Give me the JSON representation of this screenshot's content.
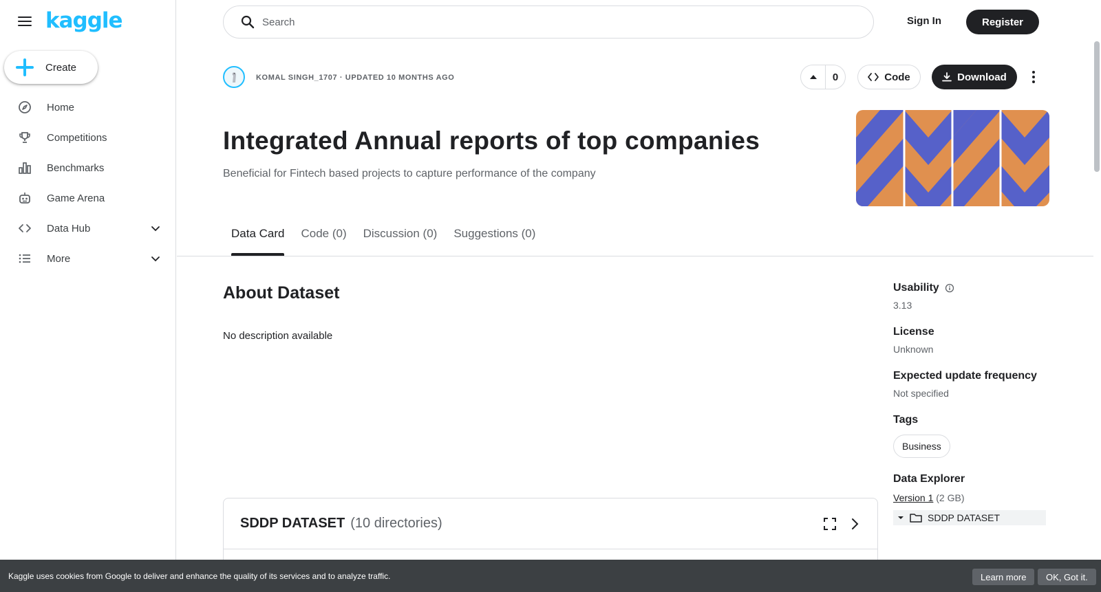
{
  "sidebar": {
    "logo": "kaggle",
    "create_label": "Create",
    "items": [
      {
        "label": "Home",
        "icon": "compass-icon"
      },
      {
        "label": "Competitions",
        "icon": "trophy-icon"
      },
      {
        "label": "Benchmarks",
        "icon": "bar-chart-icon"
      },
      {
        "label": "Game Arena",
        "icon": "robot-icon"
      },
      {
        "label": "Data Hub",
        "icon": "code-brackets-icon",
        "expandable": true
      },
      {
        "label": "More",
        "icon": "list-icon",
        "expandable": true
      }
    ]
  },
  "topbar": {
    "search_placeholder": "Search",
    "signin_label": "Sign In",
    "register_label": "Register"
  },
  "dataset": {
    "meta": "KOMAL SINGH_1707 · UPDATED 10 MONTHS AGO",
    "vote_count": "0",
    "code_label": "Code",
    "download_label": "Download",
    "title": "Integrated Annual reports of top companies",
    "subtitle": "Beneficial for Fintech based projects to capture performance of the company"
  },
  "tabs": [
    {
      "label": "Data Card",
      "active": true
    },
    {
      "label": "Code (0)",
      "active": false
    },
    {
      "label": "Discussion (0)",
      "active": false
    },
    {
      "label": "Suggestions (0)",
      "active": false
    }
  ],
  "about": {
    "title": "About Dataset",
    "description": "No description available"
  },
  "data_card": {
    "name": "SDDP DATASET",
    "count": "(10 directories)"
  },
  "side": {
    "usability_label": "Usability",
    "usability_value": "3.13",
    "license_label": "License",
    "license_value": "Unknown",
    "frequency_label": "Expected update frequency",
    "frequency_value": "Not specified",
    "tags_label": "Tags",
    "tag": "Business",
    "explorer_label": "Data Explorer",
    "version_label": "Version 1",
    "version_size": "(2 GB)",
    "folder_label": "SDDP DATASET"
  },
  "cookie": {
    "text": "Kaggle uses cookies from Google to deliver and enhance the quality of its services and to analyze traffic.",
    "learn_more": "Learn more",
    "ok": "OK, Got it."
  },
  "colors": {
    "brand": "#20beff",
    "cover_blue": "#5661c9",
    "cover_orange": "#e0904f",
    "dark_button": "#202124"
  }
}
